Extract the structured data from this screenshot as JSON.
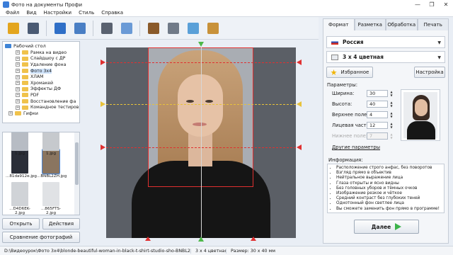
{
  "window": {
    "title": "Фото на документы Профи",
    "controls": [
      "—",
      "❐",
      "✕"
    ]
  },
  "menu": [
    "Файл",
    "Вид",
    "Настройки",
    "Стиль",
    "Справка"
  ],
  "toolbar": {
    "icons": [
      "open-folder",
      "save",
      "print",
      "user",
      "camera",
      "image-edit",
      "book",
      "film",
      "tools",
      "box"
    ],
    "colors": [
      "#e3a51e",
      "#4a5a73",
      "#2f6fc7",
      "#4a7fc4",
      "#5a6270",
      "#6a9ad6",
      "#8a5a2a",
      "#707a88",
      "#5aa0d8",
      "#c8923a"
    ]
  },
  "tree": {
    "root": "Рабочий стол",
    "items": [
      "Рамка на видео",
      "Слайдшоу с ДР",
      "Удаление фона",
      "Фото 3х4",
      "ХЛАМ",
      "Хромакей",
      "Эффекты ДФ",
      "PDF",
      "Восстановление фа",
      "Командное тестиров",
      "Гифки"
    ],
    "selected": 3
  },
  "thumbs": [
    {
      "label": "1.jpg",
      "color": "#b7bcc4"
    },
    {
      "label": "1.jpg",
      "color": "#c6c9cd"
    },
    {
      "label": "...81da912e.jpg",
      "color": "#2a2e38"
    },
    {
      "label": "...BNBL2ZH.jpg",
      "color": "#8a7560"
    },
    {
      "label": "...D4D6EK-2.jpg",
      "color": "#d0d3d7"
    },
    {
      "label": "...865FTS-2.jpg",
      "color": "#e0e2e5"
    }
  ],
  "left_buttons": {
    "open": "Открыть",
    "actions": "Действия",
    "compare": "Сравнение фотографий"
  },
  "tabs": [
    "Формат",
    "Разметка",
    "Обработка",
    "Печать"
  ],
  "active_tab": 0,
  "country": "Россия",
  "size": "3 x 4 цветная",
  "buttons": {
    "favorites": "Избранное",
    "settings": "Настройка",
    "other": "Другие параметры",
    "next": "Далее"
  },
  "params": {
    "title": "Параметры:",
    "rows": [
      {
        "label": "Ширина:",
        "value": "30",
        "disabled": false
      },
      {
        "label": "Высота:",
        "value": "40",
        "disabled": false
      },
      {
        "label": "Верхнее поле:",
        "value": "4",
        "disabled": false
      },
      {
        "label": "Лицевая часть:",
        "value": "12",
        "disabled": false
      },
      {
        "label": "Нижнее поле:",
        "value": "7",
        "disabled": true
      }
    ]
  },
  "info": {
    "title": "Информация:",
    "items": [
      "Расположение строго анфас, без поворотов",
      "Взгляд прямо в объектив",
      "Нейтральное выражение лица",
      "Глаза открыты и ясно видны",
      "Без головных уборов и тёмных очков",
      "Изображение резкое и чёткое",
      "Средний контраст без глубоких теней",
      "Однотонный фон светлее лица",
      "Вы сможете заменить фон прямо в программе!"
    ]
  },
  "status": {
    "path": "D:\\Видеоурок\\Фото 3х4\\blonde-beautiful-woman-in-black-t-shirt-studio-sho-BNBL2ZH.jpg",
    "format": "3 x 4 цветная",
    "size": "Размер: 30 x 40 мм"
  },
  "colors": {
    "guide_red": "#e03030",
    "guide_yellow": "#e8c23a",
    "arrow_green": "#4db848",
    "star": "#f0b400",
    "next_arrow": "#3db34a"
  }
}
